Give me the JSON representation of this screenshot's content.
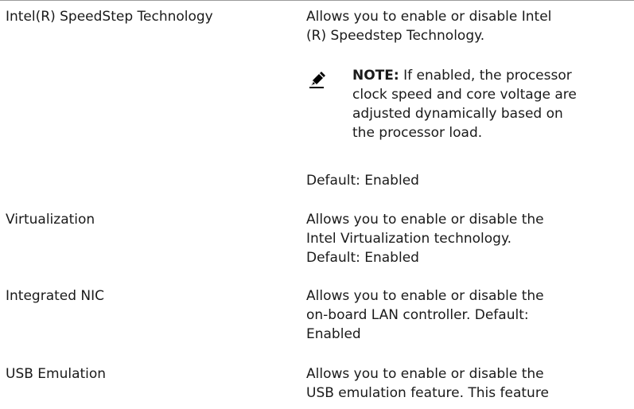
{
  "rows": [
    {
      "term": "Intel(R) SpeedStep Technology",
      "desc_l1": "Allows you to enable or disable Intel",
      "desc_l2": "(R) Speedstep Technology.",
      "note_label": "NOTE:",
      "note_l1": " If enabled, the processor",
      "note_l2": "clock speed and core voltage are",
      "note_l3": "adjusted dynamically based on",
      "note_l4": "the processor load.",
      "default": "Default: Enabled"
    },
    {
      "term": "Virtualization",
      "desc_l1": "Allows you to enable or disable the",
      "desc_l2": "Intel Virtualization technology.",
      "desc_l3": "Default: Enabled"
    },
    {
      "term": "Integrated NIC",
      "desc_l1": "Allows you to enable or disable the",
      "desc_l2": "on-board LAN controller. Default:",
      "desc_l3": "Enabled"
    },
    {
      "term": "USB Emulation",
      "desc_l1": "Allows you to enable or disable the",
      "desc_l2": "USB emulation feature. This feature"
    }
  ],
  "icons": {
    "note": "pencil-icon"
  }
}
